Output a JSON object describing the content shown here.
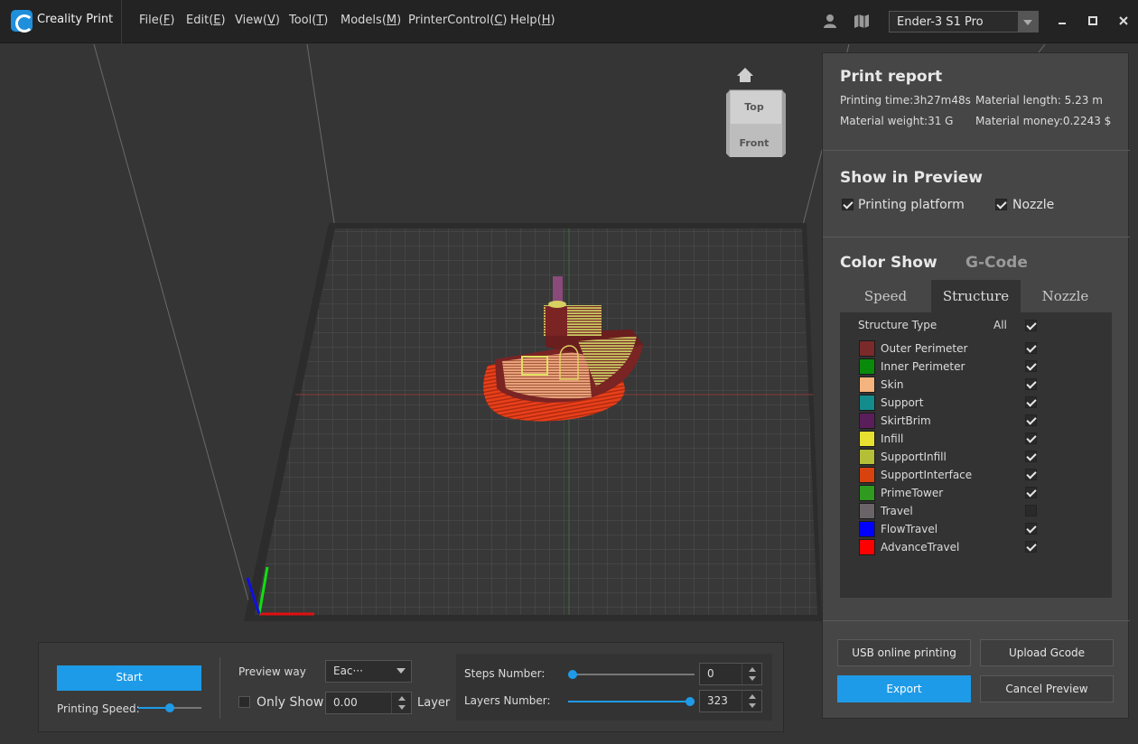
{
  "app": {
    "title": "Creality Print"
  },
  "menu": [
    {
      "label": "File",
      "key": "F"
    },
    {
      "label": "Edit",
      "key": "E"
    },
    {
      "label": "View",
      "key": "V"
    },
    {
      "label": "Tool",
      "key": "T"
    },
    {
      "label": "Models",
      "key": "M"
    },
    {
      "label": "PrinterControl",
      "key": "C"
    },
    {
      "label": "Help",
      "key": "H"
    }
  ],
  "toolbar": {
    "printer": "Ender-3 S1 Pro",
    "icons": [
      "user-icon",
      "map-icon"
    ],
    "window_buttons": [
      "minimize-icon",
      "maximize-icon",
      "close-icon"
    ]
  },
  "view_cube": {
    "home_icon": "home-icon",
    "top": "Top",
    "front": "Front"
  },
  "print_report": {
    "title": "Print report",
    "printing_time": "Printing time:3h27m48s",
    "material_length": "Material length: 5.23 m",
    "material_weight": "Material weight:31 G",
    "material_money": "Material money:0.2243 $"
  },
  "show_in_preview": {
    "title": "Show in Preview",
    "options": [
      {
        "label": "Printing platform",
        "checked": true
      },
      {
        "label": "Nozzle",
        "checked": true
      }
    ]
  },
  "color_show": {
    "title": "Color Show",
    "subtitle": "G-Code",
    "tabs": [
      "Speed",
      "Structure",
      "Nozzle"
    ],
    "active_tab": "Structure",
    "header_label": "Structure Type",
    "all_label": "All",
    "all_checked": true,
    "items": [
      {
        "label": "Outer Perimeter",
        "color": "#7a2a2a",
        "checked": true
      },
      {
        "label": "Inner Perimeter",
        "color": "#0a8a0a",
        "checked": true
      },
      {
        "label": "Skin",
        "color": "#f5b47d",
        "checked": true
      },
      {
        "label": "Support",
        "color": "#138c8c",
        "checked": true
      },
      {
        "label": "SkirtBrim",
        "color": "#5a1f5a",
        "checked": true
      },
      {
        "label": "Infill",
        "color": "#e8e030",
        "checked": true
      },
      {
        "label": "SupportInfill",
        "color": "#b4be36",
        "checked": true
      },
      {
        "label": "SupportInterface",
        "color": "#d8420f",
        "checked": true
      },
      {
        "label": "PrimeTower",
        "color": "#2f9a1f",
        "checked": true
      },
      {
        "label": "Travel",
        "color": "#6a6468",
        "checked": false
      },
      {
        "label": "FlowTravel",
        "color": "#0000ff",
        "checked": true
      },
      {
        "label": "AdvanceTravel",
        "color": "#ff0000",
        "checked": true
      }
    ]
  },
  "panel_buttons": {
    "usb": "USB online printing",
    "upload": "Upload Gcode",
    "export": "Export",
    "cancel": "Cancel Preview"
  },
  "bottom": {
    "start": "Start",
    "printing_speed": "Printing Speed:",
    "preview_way_label": "Preview way",
    "preview_way_value": "Eac···",
    "only_show_label": "Only Show",
    "only_show_checked": false,
    "only_show_value": "0.00",
    "layer_label": "Layer",
    "steps_label": "Steps Number:",
    "steps_value": "0",
    "steps_fraction": 0.0,
    "layers_label": "Layers Number:",
    "layers_value": "323",
    "layers_fraction": 1.0,
    "speed_fraction": 0.5
  },
  "colors": {
    "accent": "#1e9be8"
  }
}
